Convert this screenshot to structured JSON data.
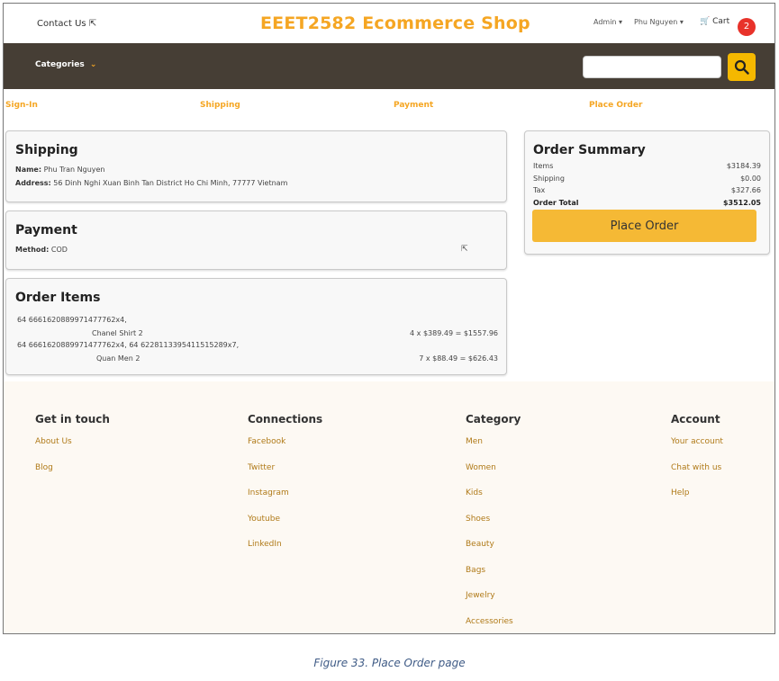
{
  "topbar": {
    "contact": "Contact Us",
    "brand": "EEET2582 Ecommerce Shop",
    "admin": "Admin",
    "user": "Phu Nguyen",
    "cart": "Cart",
    "cart_count": "2"
  },
  "nav": {
    "categories": "Categories",
    "search_placeholder": ""
  },
  "steps": [
    "Sign-In",
    "Shipping",
    "Payment",
    "Place Order"
  ],
  "shipping": {
    "title": "Shipping",
    "name_label": "Name:",
    "name": "Phu Tran Nguyen",
    "address_label": "Address:",
    "address": "56 Dinh Nghi Xuan Binh Tan District Ho Chi Minh, 77777 Vietnam"
  },
  "payment": {
    "title": "Payment",
    "method_label": "Method:",
    "method": "COD"
  },
  "order_items": {
    "title": "Order Items",
    "items": [
      {
        "ids": "64 6661620889971477762x4,",
        "name": "Chanel Shirt 2",
        "calc": "4 x $389.49 = $1557.96"
      },
      {
        "ids": "64 6661620889971477762x4, 64 6228113395411515289x7,",
        "name": "Quan Men 2",
        "calc": "7 x $88.49 = $626.43"
      }
    ]
  },
  "summary": {
    "title": "Order Summary",
    "rows": [
      {
        "label": "Items",
        "value": "$3184.39"
      },
      {
        "label": "Shipping",
        "value": "$0.00"
      },
      {
        "label": "Tax",
        "value": "$327.66"
      },
      {
        "label": "Order Total",
        "value": "$3512.05"
      }
    ],
    "button": "Place Order"
  },
  "footer": {
    "columns": [
      {
        "title": "Get in touch",
        "links": [
          "About Us",
          "Blog"
        ]
      },
      {
        "title": "Connections",
        "links": [
          "Facebook",
          "Twitter",
          "Instagram",
          "Youtube",
          "LinkedIn"
        ]
      },
      {
        "title": "Category",
        "links": [
          "Men",
          "Women",
          "Kids",
          "Shoes",
          "Beauty",
          "Bags",
          "Jewelry",
          "Accessories"
        ]
      },
      {
        "title": "Account",
        "links": [
          "Your account",
          "Chat with us",
          "Help"
        ]
      }
    ]
  },
  "caption": "Figure 33. Place Order page",
  "colors": {
    "accent": "#f5a623",
    "nav_bg": "#463e35",
    "button": "#f5b935",
    "badge": "#e8322a"
  },
  "icons": {
    "contact": "share-icon",
    "cart": "cart-icon",
    "search": "search-icon",
    "categories": "chevron-down-icon"
  }
}
